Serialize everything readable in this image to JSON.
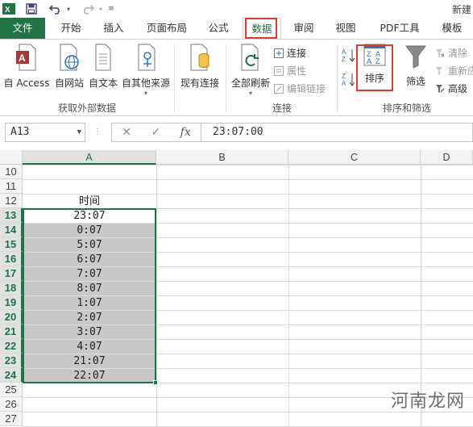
{
  "titlebar": {
    "title": "新建"
  },
  "tabs": [
    {
      "label": "文件"
    },
    {
      "label": "开始"
    },
    {
      "label": "插入"
    },
    {
      "label": "页面布局"
    },
    {
      "label": "公式"
    },
    {
      "label": "数据"
    },
    {
      "label": "审阅"
    },
    {
      "label": "视图"
    },
    {
      "label": "PDF工具"
    },
    {
      "label": "模板"
    }
  ],
  "ribbon": {
    "get_external": {
      "access": "自 Access",
      "web": "自网站",
      "text": "自文本",
      "other": "自其他来源",
      "group_label": "获取外部数据"
    },
    "existing": "现有连接",
    "connections": {
      "refresh_all": "全部刷新",
      "connect": "连接",
      "properties": "属性",
      "edit_links": "编辑链接",
      "group_label": "连接"
    },
    "sort_filter": {
      "sort": "排序",
      "filter": "筛选",
      "clear": "清除",
      "reapply": "重新应",
      "advanced": "高级",
      "group_label": "排序和筛选"
    }
  },
  "formula_bar": {
    "name_box": "A13",
    "cancel": "✕",
    "enter": "✓",
    "fx": "fx",
    "value": "23:07:00"
  },
  "grid": {
    "columns": [
      "A",
      "B",
      "C",
      "D"
    ],
    "rows": [
      "10",
      "11",
      "12",
      "13",
      "14",
      "15",
      "16",
      "17",
      "18",
      "19",
      "20",
      "21",
      "22",
      "23",
      "24",
      "25",
      "26",
      "27"
    ],
    "header_cell": "时间",
    "values": [
      "23:07",
      "0:07",
      "5:07",
      "6:07",
      "7:07",
      "8:07",
      "1:07",
      "2:07",
      "3:07",
      "4:07",
      "21:07",
      "22:07"
    ]
  },
  "watermark": "河南龙网",
  "colors": {
    "excel_green": "#217346",
    "highlight_red": "#e53935",
    "shade": "#c8c8c8"
  }
}
